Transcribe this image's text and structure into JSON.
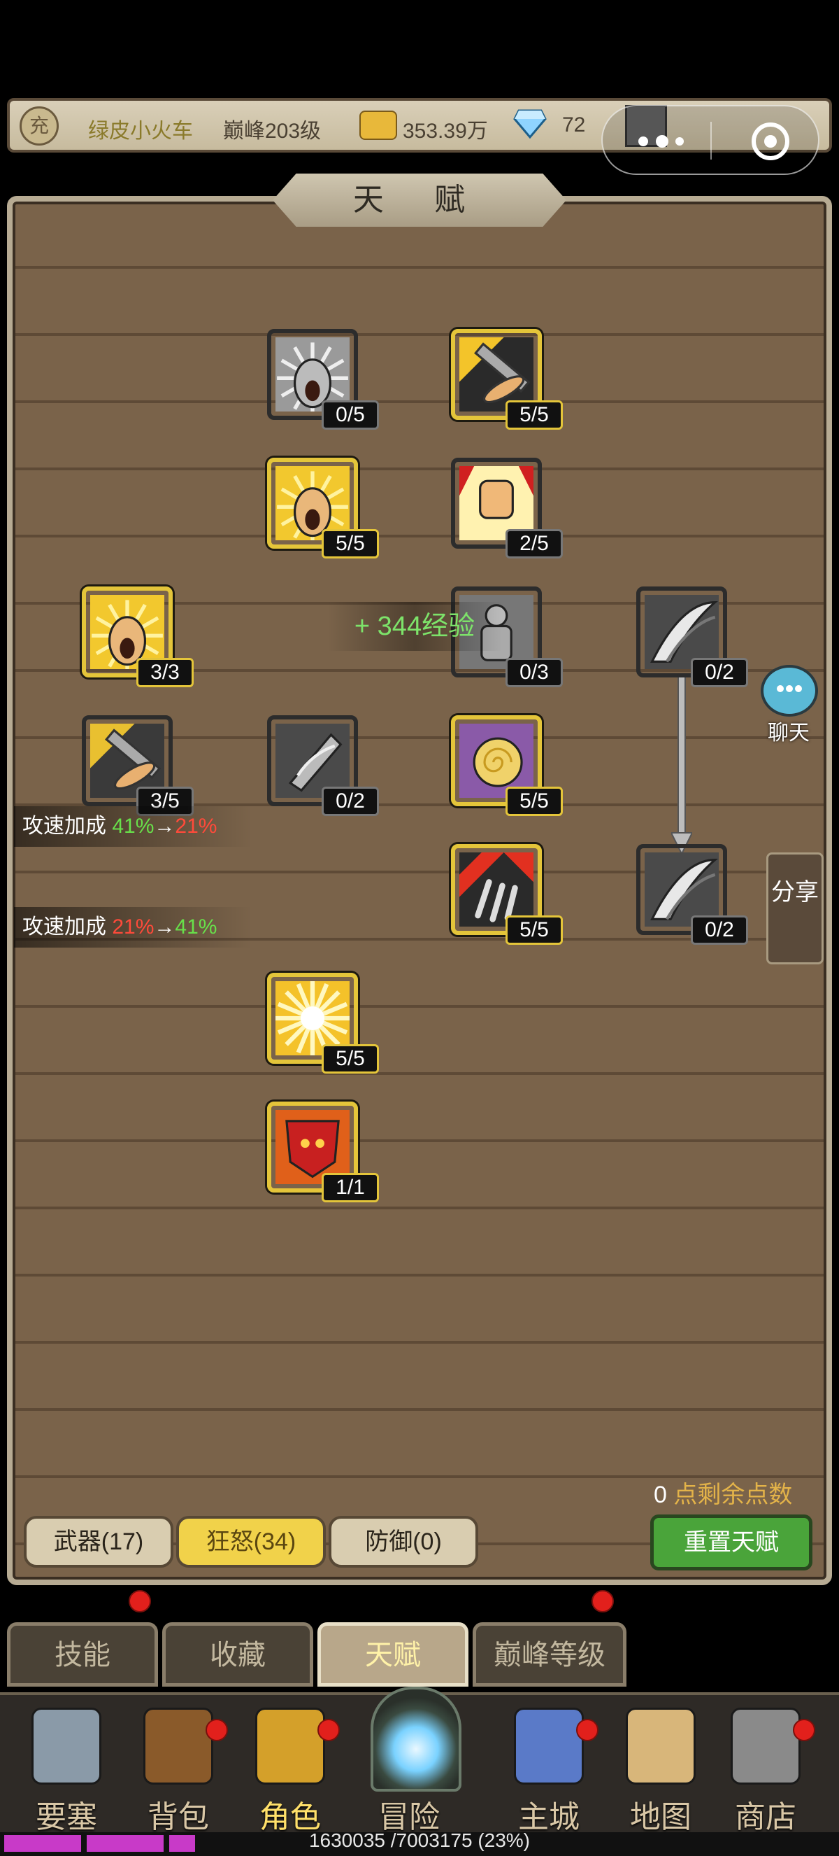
{
  "header": {
    "vip_glyph": "充",
    "player_name": "绿皮小火车",
    "peak_level": "巅峰203级",
    "gold": "353.39万",
    "diamonds": "72"
  },
  "panel": {
    "title": "天 赋",
    "exp_popup": "+ 344经验"
  },
  "talents": [
    {
      "id": "howl-gray",
      "level": "0/5",
      "active": false,
      "icon": "howling-face-icon"
    },
    {
      "id": "sword-gold",
      "level": "5/5",
      "active": true,
      "icon": "sword-strike-icon"
    },
    {
      "id": "howl-gold",
      "level": "5/5",
      "active": true,
      "icon": "howling-face-icon"
    },
    {
      "id": "fist",
      "level": "2/5",
      "active": false,
      "icon": "fist-icon"
    },
    {
      "id": "howl-left",
      "level": "3/3",
      "active": true,
      "icon": "howling-face-icon"
    },
    {
      "id": "stone-warrior",
      "level": "0/3",
      "active": false,
      "icon": "stone-warrior-icon"
    },
    {
      "id": "blade-top",
      "level": "0/2",
      "active": false,
      "icon": "blade-slash-icon"
    },
    {
      "id": "sword-left",
      "level": "3/5",
      "active": false,
      "icon": "sword-strike-icon"
    },
    {
      "id": "shield-slash",
      "level": "0/2",
      "active": false,
      "icon": "shield-slash-icon"
    },
    {
      "id": "spiral",
      "level": "5/5",
      "active": true,
      "icon": "spiral-vortex-icon"
    },
    {
      "id": "claw",
      "level": "5/5",
      "active": true,
      "icon": "claw-icon"
    },
    {
      "id": "blade-bottom",
      "level": "0/2",
      "active": false,
      "icon": "blade-slash-icon"
    },
    {
      "id": "burst",
      "level": "5/5",
      "active": true,
      "icon": "light-burst-icon"
    },
    {
      "id": "rage-flag",
      "level": "1/1",
      "active": true,
      "icon": "rage-banner-icon"
    }
  ],
  "tooltips": [
    {
      "label": "攻速加成 ",
      "from": "41%",
      "arrow": "→",
      "to": "21%"
    },
    {
      "label": "攻速加成 ",
      "from": "21%",
      "arrow": "→",
      "to": "41%"
    }
  ],
  "side": {
    "chat": "聊天",
    "share": "分享"
  },
  "points": {
    "value": "0",
    "label": "点剩余点数"
  },
  "categories": [
    {
      "label": "武器(17)",
      "selected": false
    },
    {
      "label": "狂怒(34)",
      "selected": true
    },
    {
      "label": "防御(0)",
      "selected": false
    }
  ],
  "reset_label": "重置天赋",
  "sub_tabs": [
    {
      "label": "技能",
      "selected": false,
      "dot": true
    },
    {
      "label": "收藏",
      "selected": false,
      "dot": false
    },
    {
      "label": "天赋",
      "selected": true,
      "dot": false
    },
    {
      "label": "巅峰等级",
      "selected": false,
      "dot": true
    }
  ],
  "nav": [
    {
      "label": "要塞",
      "icon": "fortress-icon",
      "dot": false,
      "selected": false
    },
    {
      "label": "背包",
      "icon": "backpack-icon",
      "dot": true,
      "selected": false
    },
    {
      "label": "角色",
      "icon": "helmet-icon",
      "dot": true,
      "selected": true
    },
    {
      "label": "冒险",
      "icon": "portal-icon",
      "dot": false,
      "selected": false
    },
    {
      "label": "主城",
      "icon": "castle-icon",
      "dot": true,
      "selected": false
    },
    {
      "label": "地图",
      "icon": "map-scroll-icon",
      "dot": false,
      "selected": false
    },
    {
      "label": "商店",
      "icon": "shop-bag-icon",
      "dot": true,
      "selected": false
    }
  ],
  "exp": {
    "text": "1630035 /7003175 (23%)",
    "fraction": 0.23
  },
  "colors": {
    "gold_border": "#e4c53a",
    "green": "#68e04a",
    "red": "#ff4a3a"
  }
}
